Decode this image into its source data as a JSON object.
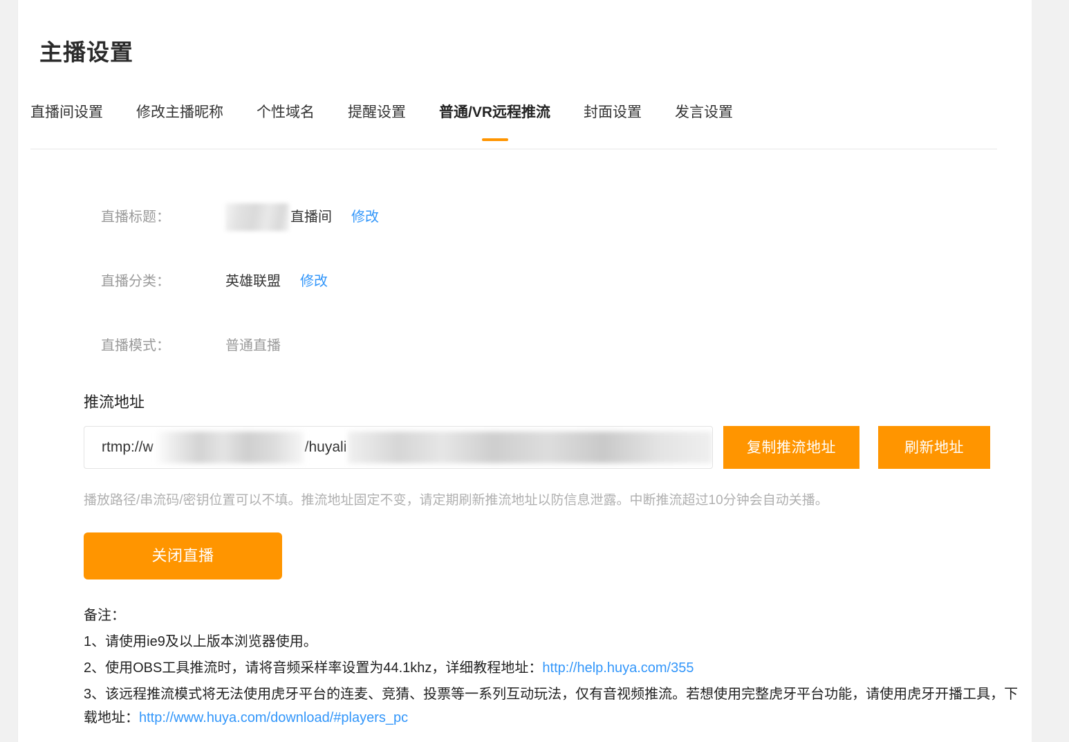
{
  "page": {
    "title": "主播设置",
    "accent_color": "#ff9500",
    "link_color": "#3296fa",
    "background_color": "#f1f1f1",
    "panel_color": "#ffffff"
  },
  "tabs": [
    {
      "label": "直播间设置",
      "active": false
    },
    {
      "label": "修改主播昵称",
      "active": false
    },
    {
      "label": "个性域名",
      "active": false
    },
    {
      "label": "提醒设置",
      "active": false
    },
    {
      "label": "普通/VR远程推流",
      "active": true
    },
    {
      "label": "封面设置",
      "active": false
    },
    {
      "label": "发言设置",
      "active": false
    }
  ],
  "info_rows": {
    "stream_title": {
      "label": "直播标题：",
      "value_suffix": "直播间",
      "value_redacted": true,
      "edit_link": "修改"
    },
    "stream_category": {
      "label": "直播分类：",
      "value": "英雄联盟",
      "edit_link": "修改"
    },
    "stream_mode": {
      "label": "直播模式：",
      "value": "普通直播"
    }
  },
  "push": {
    "section_title": "推流地址",
    "url_prefix": "rtmp://w",
    "url_middle": "/huyali",
    "url_redacted": true,
    "copy_button": "复制推流地址",
    "refresh_button": "刷新地址",
    "hint": "播放路径/串流码/密钥位置可以不填。推流地址固定不变，请定期刷新推流地址以防信息泄露。中断推流超过10分钟会自动关播。",
    "stop_button": "关闭直播"
  },
  "remarks": {
    "heading": "备注：",
    "item1": "1、请使用ie9及以上版本浏览器使用。",
    "item2_text": "2、使用OBS工具推流时，请将音频采样率设置为44.1khz，详细教程地址：",
    "item2_link": "http://help.huya.com/355",
    "item3_text": "3、该远程推流模式将无法使用虎牙平台的连麦、竞猜、投票等一系列互动玩法，仅有音视频推流。若想使用完整虎牙平台功能，请使用虎牙开播工具，下载地址：",
    "item3_link": "http://www.huya.com/download/#players_pc"
  }
}
